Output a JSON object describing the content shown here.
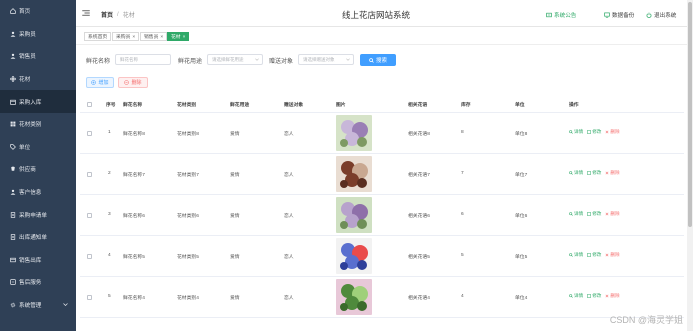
{
  "sidebar": {
    "items": [
      {
        "label": "首页",
        "icon": "home-icon"
      },
      {
        "label": "采购员",
        "icon": "user-icon"
      },
      {
        "label": "销售员",
        "icon": "user-icon"
      },
      {
        "label": "花材",
        "icon": "flower-icon"
      },
      {
        "label": "采购入库",
        "icon": "box-icon"
      },
      {
        "label": "花材类别",
        "icon": "grid-icon"
      },
      {
        "label": "单位",
        "icon": "tag-icon"
      },
      {
        "label": "供应商",
        "icon": "truck-icon"
      },
      {
        "label": "客户信息",
        "icon": "user-icon"
      },
      {
        "label": "采购申请单",
        "icon": "doc-icon"
      },
      {
        "label": "出库通知单",
        "icon": "doc-icon"
      },
      {
        "label": "销售出库",
        "icon": "cart-icon"
      },
      {
        "label": "售后服务",
        "icon": "service-icon"
      },
      {
        "label": "系统管理",
        "icon": "gear-icon"
      }
    ]
  },
  "header": {
    "home": "首页",
    "separator": "/",
    "current": "花材",
    "title": "线上花店网站系统",
    "notice": "系统公告",
    "backup": "数据备份",
    "logout": "退出系统"
  },
  "tags": [
    {
      "label": "系统首页",
      "closable": false
    },
    {
      "label": "采购员",
      "closable": true
    },
    {
      "label": "销售员",
      "closable": true
    },
    {
      "label": "花材",
      "closable": true,
      "active": true
    }
  ],
  "search": {
    "name_label": "鲜花名称",
    "name_placeholder": "鲜花名称",
    "use_label": "鲜花用途",
    "use_placeholder": "请选择鲜花用途",
    "target_label": "赠送对象",
    "target_placeholder": "请选择赠送对象",
    "button": "搜索"
  },
  "actions": {
    "add": "增加",
    "delete": "删除"
  },
  "table": {
    "columns": [
      "序号",
      "鲜花名称",
      "花材类别",
      "鲜花用途",
      "赠送对象",
      "图片",
      "相关花语",
      "库存",
      "单位",
      "操作"
    ],
    "rows": [
      {
        "index": "1",
        "name": "鲜花名称8",
        "category": "花材类别8",
        "use": "爱情",
        "target": "恋人",
        "language": "相关花语8",
        "stock": "8",
        "unit": "单位8"
      },
      {
        "index": "2",
        "name": "鲜花名称7",
        "category": "花材类别7",
        "use": "爱情",
        "target": "恋人",
        "language": "相关花语7",
        "stock": "7",
        "unit": "单位7"
      },
      {
        "index": "3",
        "name": "鲜花名称6",
        "category": "花材类别6",
        "use": "爱情",
        "target": "恋人",
        "language": "相关花语6",
        "stock": "6",
        "unit": "单位6"
      },
      {
        "index": "4",
        "name": "鲜花名称5",
        "category": "花材类别5",
        "use": "爱情",
        "target": "恋人",
        "language": "相关花语5",
        "stock": "5",
        "unit": "单位5"
      },
      {
        "index": "5",
        "name": "鲜花名称4",
        "category": "花材类别4",
        "use": "爱情",
        "target": "恋人",
        "language": "相关花语4",
        "stock": "4",
        "unit": "单位4"
      }
    ],
    "ops": {
      "detail": "详情",
      "edit": "修改",
      "remove": "删除"
    }
  },
  "watermark": "CSDN @海灵学姐",
  "colors": {
    "sidebar": "#2f4056",
    "accent": "#2fa968",
    "primary": "#409eff",
    "danger": "#f56c6c"
  }
}
